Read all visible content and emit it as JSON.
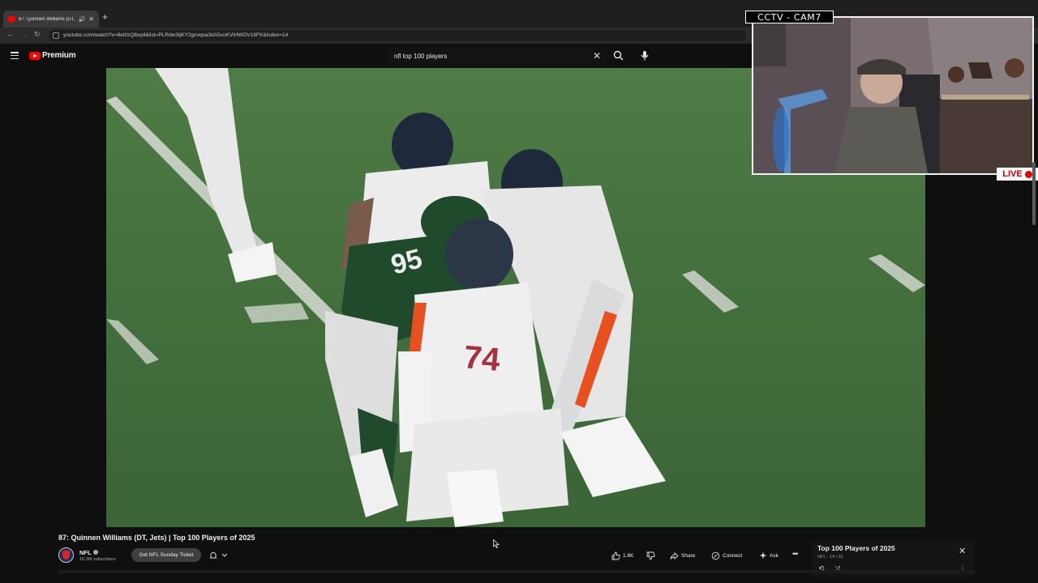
{
  "browser": {
    "tab_title": "87: Quinnen Williams (DT, ...",
    "url": "youtube.com/watch?v=8etIlzQ8xq4&list=PLRdw3IjKY2gnvqxa3dA5xoKViHWOV16FK&index=14"
  },
  "header": {
    "logo_label": "Premium",
    "search_query": "nfl top 100 players"
  },
  "overlay": {
    "cam_label": "CCTV - CAM7",
    "live_label": "LIVE"
  },
  "video": {
    "title": "87: Quinnen Williams (DT, Jets) | Top 100 Players of 2025",
    "jersey_numbers": [
      "95",
      "74"
    ]
  },
  "channel": {
    "name": "NFL",
    "subscribers": "16.3M subscribers",
    "ticket_button": "Get NFL Sunday Ticket"
  },
  "actions": {
    "likes": "1.8K",
    "share": "Share",
    "connect": "Connect",
    "ask": "Ask"
  },
  "playlist": {
    "title": "Top 100 Players of 2025",
    "position": "NFL - 14 / 91"
  },
  "colors": {
    "youtube_red": "#ff0000",
    "live_red": "#e00000",
    "broncos_orange": "#e8501f",
    "jets_green": "#1f4a2c"
  }
}
